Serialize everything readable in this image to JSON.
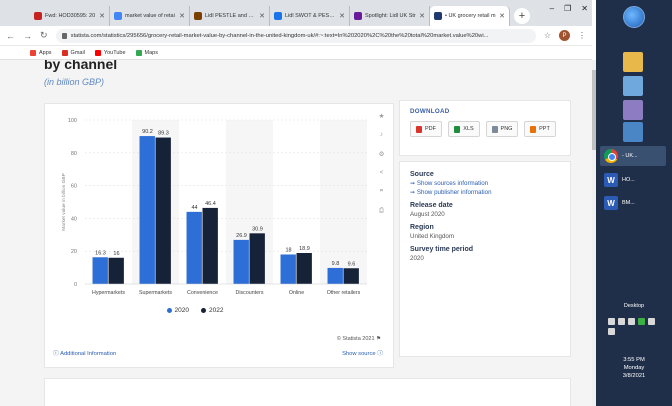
{
  "browser": {
    "tabs": [
      {
        "label": "Fwd: HOD30595: 20",
        "color": "#c5221f",
        "active": false
      },
      {
        "label": "market value of retai",
        "color": "#4285f4",
        "active": false
      },
      {
        "label": "Lidl PESTLE and Micr",
        "color": "#7b3f00",
        "active": false
      },
      {
        "label": "Lidl SWOT & PESTLE",
        "color": "#1a73e8",
        "active": false
      },
      {
        "label": "Spotlight: Lidl UK Str",
        "color": "#6a1b9a",
        "active": false
      },
      {
        "label": "• UK grocery retail m",
        "color": "#1e3a6e",
        "active": true
      }
    ],
    "new_tab": "+",
    "window_controls": {
      "minimize": "–",
      "maximize": "❐",
      "close": "✕"
    },
    "url": "statista.com/statistics/295656/grocery-retail-market-value-by-channel-in-the-united-kingdom-uk/#:~:text=In%202020%2C%20the%20total%20market.value%20wi...",
    "profile_initial": "P",
    "bookmarks": [
      {
        "label": "Apps",
        "color": "#ea4335"
      },
      {
        "label": "Gmail",
        "color": "#d93025"
      },
      {
        "label": "YouTube",
        "color": "#ff0000"
      },
      {
        "label": "Maps",
        "color": "#34a853"
      }
    ]
  },
  "page": {
    "heading": "by channel",
    "subheading": "(in billion GBP)"
  },
  "chart_data": {
    "type": "bar",
    "categories": [
      "Hypermarkets",
      "Supermarkets",
      "Convenience",
      "Discounters",
      "Online",
      "Other retailers"
    ],
    "series": [
      {
        "name": "2020",
        "values": [
          16.3,
          90.2,
          44,
          26.9,
          18,
          9.8
        ],
        "color": "#2d6fd6"
      },
      {
        "name": "2022",
        "values": [
          16,
          89.3,
          46.4,
          30.9,
          18.9,
          9.6
        ],
        "color": "#152238"
      }
    ],
    "value_labels": [
      [
        "16.3",
        "90.2",
        "44",
        "26.9",
        "18",
        "9.8"
      ],
      [
        "16",
        "89.3",
        "46.4",
        "30.9",
        "18.9",
        "9.6"
      ]
    ],
    "ylabel": "Market value in billion GBP",
    "ylim": [
      0,
      100
    ],
    "yticks": [
      "0",
      "20",
      "40",
      "60",
      "80",
      "100"
    ],
    "grid": true,
    "legend": "bottom-center"
  },
  "chart_footer": {
    "copyright": "© Statista 2021",
    "additional_info": "Additional Information",
    "show_source": "Show source"
  },
  "download": {
    "title": "DOWNLOAD",
    "buttons": [
      {
        "label": "PDF",
        "color": "#d9342b"
      },
      {
        "label": "XLS",
        "color": "#1e8e3e"
      },
      {
        "label": "PNG",
        "color": "#7d8a99"
      },
      {
        "label": "PPT",
        "color": "#e8710a"
      }
    ]
  },
  "meta": {
    "source_label": "Source",
    "show_sources": "➞ Show sources information",
    "show_publisher": "➞ Show publisher information",
    "release_label": "Release date",
    "release_value": "August 2020",
    "region_label": "Region",
    "region_value": "United Kingdom",
    "survey_label": "Survey time period",
    "survey_value": "2020"
  },
  "taskbar": {
    "chrome_label": "- UK...",
    "word1_label": "HO...",
    "word2_label": "BM...",
    "desktop_label": "Desktop",
    "time": "3:55 PM",
    "day": "Monday",
    "date": "3/8/2021"
  }
}
